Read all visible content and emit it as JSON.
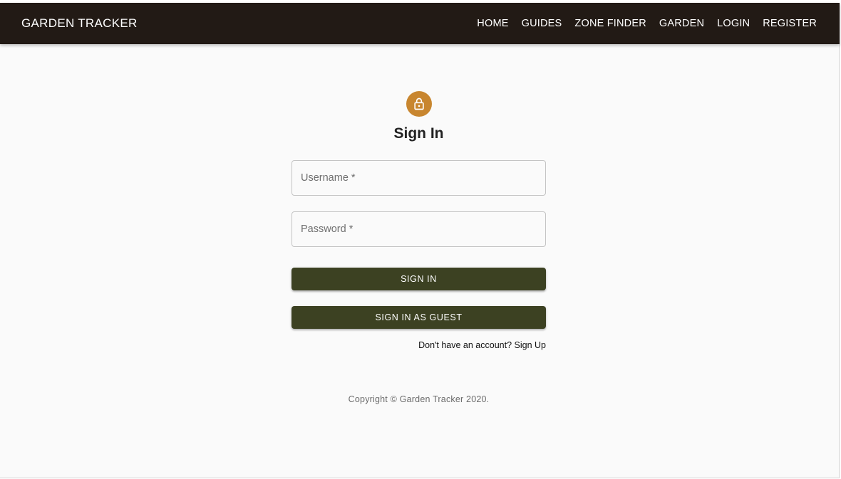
{
  "header": {
    "brand": "GARDEN TRACKER",
    "nav": [
      {
        "label": "HOME"
      },
      {
        "label": "GUIDES"
      },
      {
        "label": "ZONE FINDER"
      },
      {
        "label": "GARDEN"
      },
      {
        "label": "LOGIN"
      },
      {
        "label": "REGISTER"
      }
    ]
  },
  "form": {
    "icon": "lock-icon",
    "title": "Sign In",
    "username": {
      "placeholder": "Username *",
      "value": ""
    },
    "password": {
      "placeholder": "Password *",
      "value": ""
    },
    "submit_label": "SIGN IN",
    "guest_label": "SIGN IN AS GUEST",
    "signup_link": "Don't have an account? Sign Up"
  },
  "footer": {
    "copyright": "Copyright © Garden Tracker 2020."
  },
  "colors": {
    "appbar": "#221a15",
    "accent": "#c8862f",
    "button": "#3c4122",
    "background": "#fafafa"
  }
}
